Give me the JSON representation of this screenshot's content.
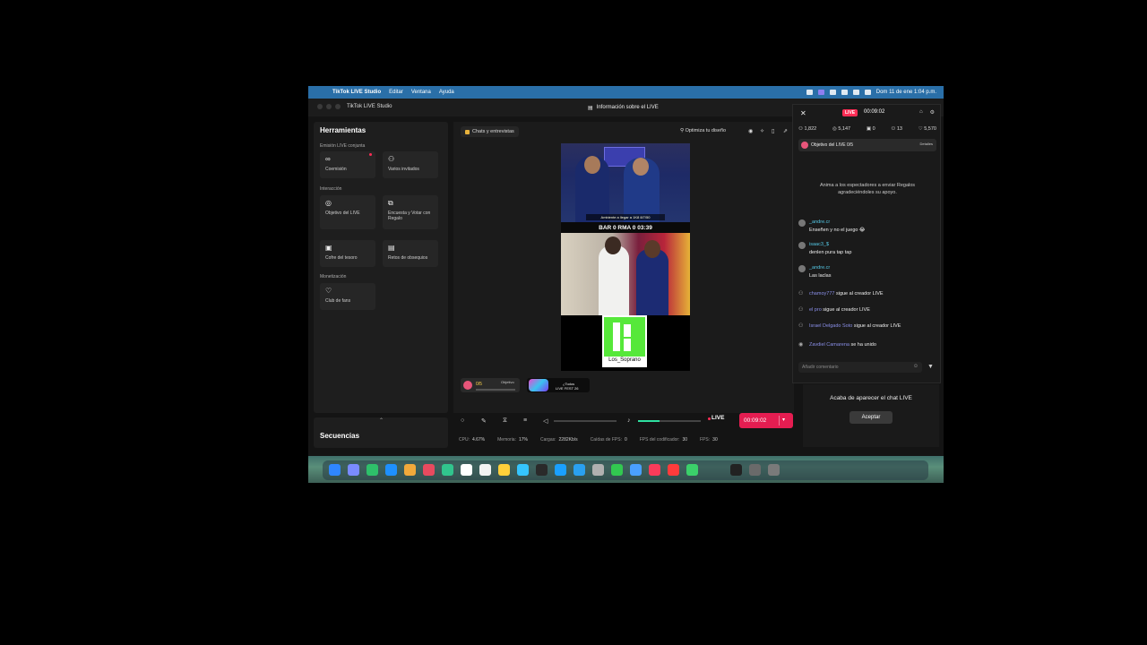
{
  "menubar": {
    "app_name": "TikTok LIVE Studio",
    "items": [
      "Editar",
      "Ventana",
      "Ayuda"
    ],
    "datetime": "Dom 11 de ene  1:04 p.m."
  },
  "window": {
    "title": "TikTok LIVE Studio",
    "info_button": "Información sobre el LIVE"
  },
  "tools": {
    "heading": "Herramientas",
    "sections": {
      "joint": "Emisión LIVE conjunta",
      "interaction": "Interacción",
      "monetization": "Monetización"
    },
    "items": {
      "coemision": "Coemisión",
      "varios": "Varios invitados",
      "objetivo": "Objetivo del LIVE",
      "encuesta": "Encuesta y Votar con Regalo",
      "cofre": "Cofre del tesoro",
      "retos": "Retos de obsequios",
      "club": "Club de fans"
    },
    "sequences": "Secuencias"
  },
  "center": {
    "chip": "Chats y entrevistas",
    "optimize": "Optimiza tu diseño",
    "preview": {
      "score": "BAR  0  RMA  0  03:39",
      "banner": "Ambiente a llegar a 1K8  8/7/50",
      "qr_name": "Los_Soprano"
    },
    "overlay_goal": "0/5",
    "overlay_goal_label": "Objetivo",
    "overlay_b_line1": "¿Todos",
    "overlay_b_line2": "LIVE FEST 26"
  },
  "controls": {
    "live_label": "LIVE",
    "timer": "00:09:02"
  },
  "stats": [
    {
      "label": "CPU:",
      "value": "4.67%"
    },
    {
      "label": "Memoria:",
      "value": "17%"
    },
    {
      "label": "Cargas:",
      "value": "2282Kb/s"
    },
    {
      "label": "Caídas de FPS:",
      "value": "0"
    },
    {
      "label": "FPS del codificador:",
      "value": "30"
    },
    {
      "label": "FPS:",
      "value": "30"
    }
  ],
  "chat": {
    "live_badge": "LIVE",
    "time": "00:09:02",
    "viewers": "1,822",
    "likes": "5,147",
    "gifts": "0",
    "shares": "13",
    "hearts": "5,570",
    "goal_title": "Objetivo del LIVE 0/5",
    "goal_detail": "Detalles",
    "hint": "Anima a los espectadores a enviar Regalos agradeciéndoles su apoyo.",
    "messages": [
      {
        "user": "_andre.cr",
        "text": "Enseñen y no el juego 😂"
      },
      {
        "user": "isaac3_$",
        "text": "denlen pura tap tap"
      },
      {
        "user": "_andre.cr",
        "text": "Las laclas"
      }
    ],
    "follows": [
      {
        "user": "chamoy777",
        "action": "sigue al creador LIVE"
      },
      {
        "user": "el pro",
        "action": "sigue al creador LIVE"
      },
      {
        "user": "Israel Delgado Soto",
        "action": "sigue al creador LIVE"
      },
      {
        "user": "Zavdiel Camarena",
        "action": "se ha unido"
      }
    ],
    "input_placeholder": "Añadir comentario"
  },
  "livechat_panel": {
    "title": "Acaba de aparecer el chat LIVE",
    "accept": "Aceptar"
  },
  "dock_colors": [
    "#2f86ff",
    "#7a8bff",
    "#2ec06a",
    "#1e90ff",
    "#f2a93b",
    "#e84a5f",
    "#31c48d",
    "#ffffff",
    "#f2f2f2",
    "#ffcf3a",
    "#35c5ff",
    "#2a2a2a",
    "#1aa0ff",
    "#2aa0f0",
    "#b0b0b0",
    "#32c850",
    "#4aa0ff",
    "#fa3b5a",
    "#ff3b3b",
    "#3bd06a",
    "#222222",
    "#6a6a6a",
    "#7a7a7a"
  ]
}
